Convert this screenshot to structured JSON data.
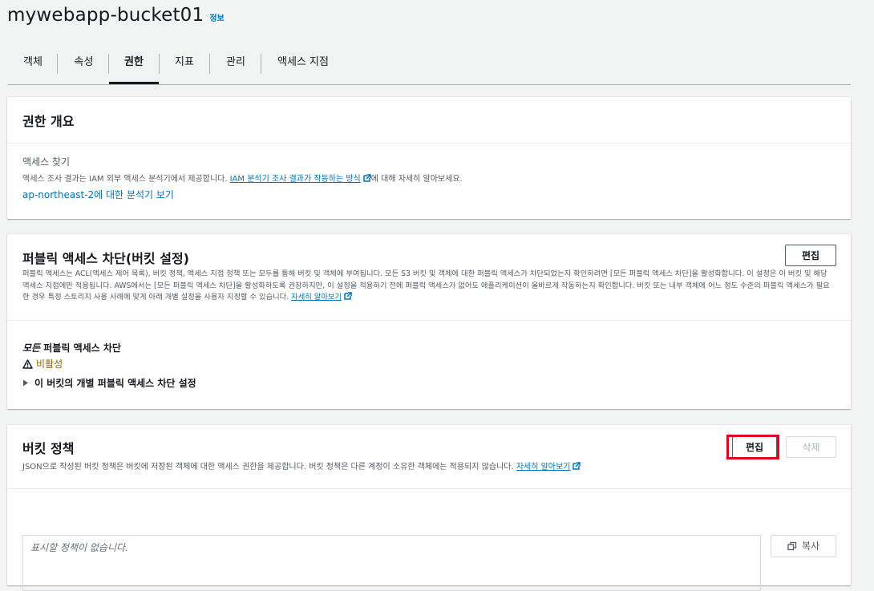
{
  "header": {
    "title": "mywebapp-bucket01",
    "info": "정보"
  },
  "tabs": [
    {
      "label": "객체"
    },
    {
      "label": "속성"
    },
    {
      "label": "권한",
      "active": true
    },
    {
      "label": "지표"
    },
    {
      "label": "관리"
    },
    {
      "label": "액세스 지점"
    }
  ],
  "overview": {
    "title": "권한 개요",
    "access_findings": "액세스 찾기",
    "desc_prefix": "액세스 조사 결과는 IAM 외부 액세스 분석기에서 제공합니다.",
    "desc_link": "IAM 분석기 조사 결과가 작동하는 방식",
    "desc_suffix": "에 대해 자세히 알아보세요.",
    "region_link": "ap-northeast-2에 대한 분석기 보기"
  },
  "public_access": {
    "title": "퍼블릭 액세스 차단(버킷 설정)",
    "edit_label": "편집",
    "description": "퍼블릭 액세스는 ACL(액세스 제어 목록), 버킷 정책, 액세스 지점 정책 또는 모두를 통해 버킷 및 객체에 부여됩니다. 모든 S3 버킷 및 객체에 대한 퍼블릭 액세스가 차단되었는지 확인하려면 [모든 퍼블릭 액세스 차단]을 활성화합니다. 이 설정은 이 버킷 및 해당 액세스 지점에만 적용됩니다. AWS에서는 [모든 퍼블릭 액세스 차단]을 활성화하도록 권장하지만, 이 설정을 적용하기 전에 퍼블릭 액세스가 없어도 애플리케이션이 올바르게 작동하는지 확인합니다. 버킷 또는 내부 객체에 어느 정도 수준의 퍼블릭 액세스가 필요한 경우 특정 스토리지 사용 사례에 맞게 아래 개별 설정을 사용자 지정할 수 있습니다.",
    "learn_more": "자세히 알아보기",
    "block_all_italic": "모든",
    "block_all_rest": " 퍼블릭 액세스 차단",
    "status": "비활성",
    "expand_label": "이 버킷의 개별 퍼블릭 액세스 차단 설정"
  },
  "bucket_policy": {
    "title": "버킷 정책",
    "edit_label": "편집",
    "delete_label": "삭제",
    "description": "JSON으로 작성된 버킷 정책은 버킷에 저장된 객체에 대한 액세스 권한을 제공합니다. 버킷 정책은 다른 계정이 소유한 객체에는 적용되지 않습니다.",
    "learn_more": "자세히 알아보기",
    "empty_text": "표시할 정책이 없습니다.",
    "copy_label": "복사"
  },
  "colors": {
    "link": "#0073bb",
    "warning": "#8d6605",
    "highlight": "#e0001b"
  },
  "icons": {
    "external": "external-link-icon",
    "warning": "warning-icon",
    "caret": "caret-right-icon",
    "copy": "copy-icon"
  }
}
